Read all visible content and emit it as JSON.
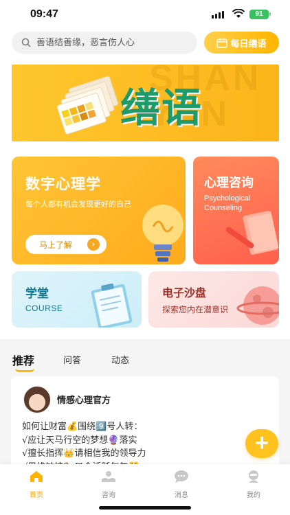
{
  "status_bar": {
    "time": "09:47",
    "battery": "91"
  },
  "search": {
    "placeholder": "善语结善缘，恶言伤人心"
  },
  "daily_button": {
    "label": "每日缮语"
  },
  "banner": {
    "title": "缮语",
    "ghost_text": "SHAN YAN"
  },
  "cards": {
    "psychology": {
      "title": "数字心理学",
      "subtitle": "每个人都有机会发现更好的自己",
      "button": "马上了解"
    },
    "consult": {
      "title": "心理咨询",
      "subtitle": "Psychological Counseling"
    },
    "course": {
      "title": "学堂",
      "subtitle": "COURSE"
    },
    "sandbox": {
      "title": "电子沙盘",
      "subtitle": "探索您内在潜意识"
    }
  },
  "feed": {
    "tabs": [
      "推荐",
      "问答",
      "动态"
    ],
    "active_tab": "推荐",
    "post": {
      "author": "情感心理官方",
      "lines": [
        "如何让财富💰围绕9️⃣号人转：",
        "√应让天马行空的梦想🔮落实",
        "√擅长指挥👑请相信我的领导力",
        "√思维敏捷🐎又会活跃气氛🎊"
      ]
    }
  },
  "fab": {
    "label": "+"
  },
  "nav": {
    "items": [
      {
        "label": "首页",
        "icon": "home-icon",
        "active": true
      },
      {
        "label": "咨询",
        "icon": "consult-icon",
        "active": false
      },
      {
        "label": "消息",
        "icon": "message-icon",
        "active": false
      },
      {
        "label": "我的",
        "icon": "profile-icon",
        "active": false
      }
    ]
  },
  "colors": {
    "accent": "#ffb800",
    "banner_text": "#1f9a6a",
    "consult": "#ff6a4f",
    "course": "#12768f",
    "sandbox": "#9a3128"
  }
}
